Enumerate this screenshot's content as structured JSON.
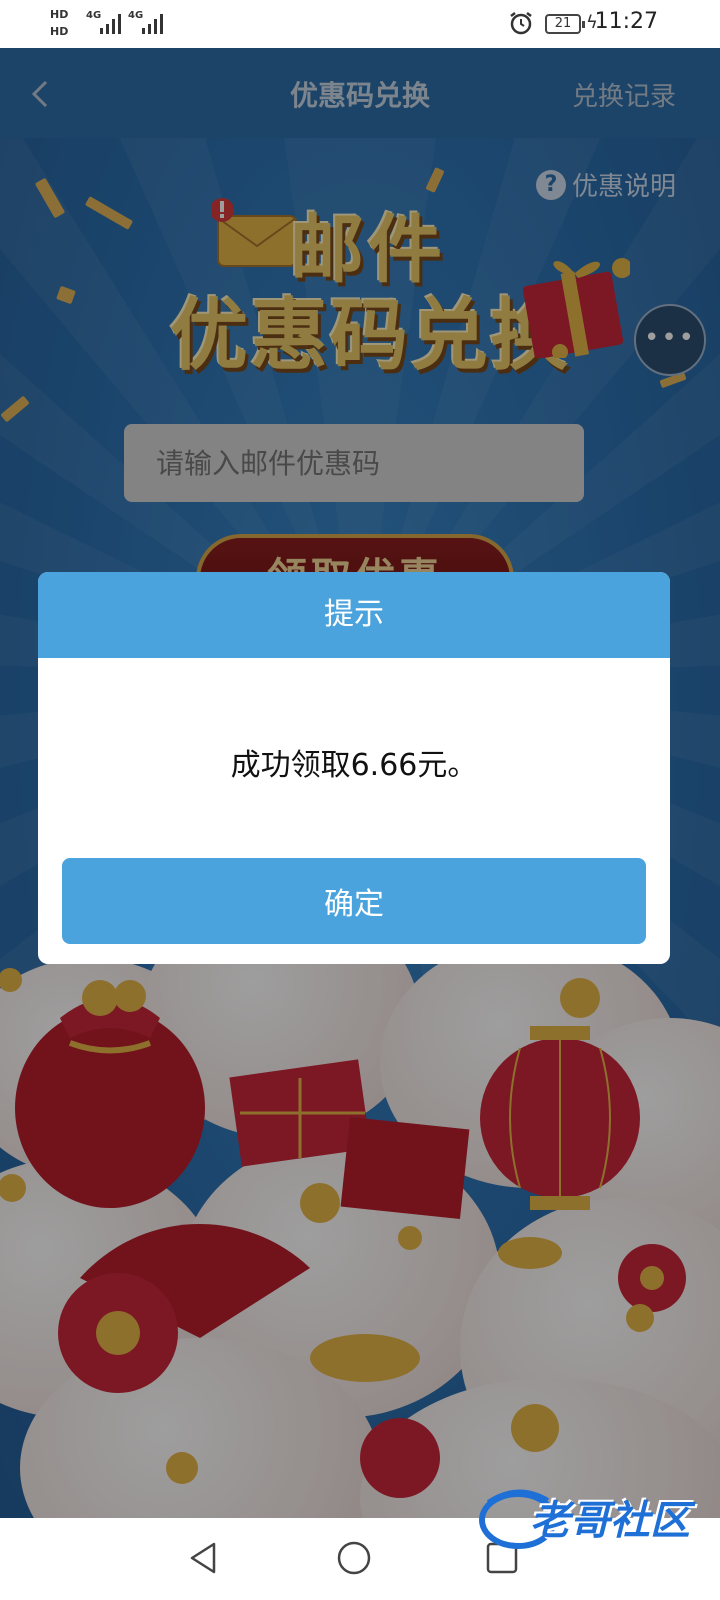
{
  "status_bar": {
    "left_top": "HD",
    "left_bottom": "HD",
    "network_1": "4G",
    "network_2": "4G",
    "battery": "21",
    "time": "11:27"
  },
  "header": {
    "title": "优惠码兑换",
    "record_label": "兑换记录"
  },
  "promo": {
    "help_label": "优惠说明",
    "banner_line1": "邮件",
    "banner_line2": "优惠码兑换",
    "input_placeholder": "请输入邮件优惠码",
    "claim_button": "领取优惠",
    "more_label": "•••"
  },
  "dialog": {
    "title": "提示",
    "message": "成功领取6.66元。",
    "confirm": "确定"
  },
  "watermark": {
    "text": "老哥社区"
  },
  "colors": {
    "header": "#2e6fa8",
    "dialog_accent": "#4aa3dc",
    "banner_gold": "#e8c76a",
    "claim_red": "#8e1f1f"
  }
}
